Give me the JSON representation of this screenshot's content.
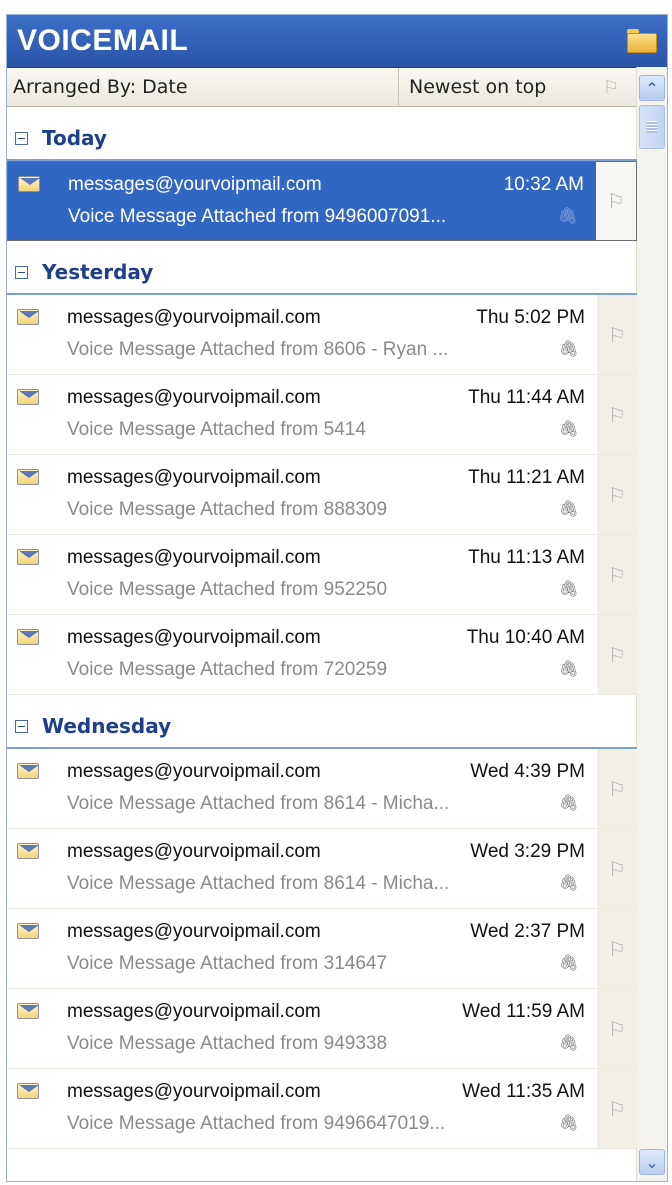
{
  "title": "VOICEMAIL",
  "arrange": {
    "by": "Arranged By: Date",
    "order": "Newest on top"
  },
  "icons": {
    "flag": "⚐",
    "attachment": "🖇",
    "scroll_up": "⌃",
    "scroll_down": "⌄"
  },
  "groups": [
    {
      "title": "Today"
    },
    {
      "title": "Yesterday"
    },
    {
      "title": "Wednesday"
    }
  ],
  "messages": [
    {
      "from": "messages@yourvoipmail.com",
      "time": "10:32 AM",
      "subject": "Voice Message Attached from 9496007091...",
      "selected": true
    },
    {
      "from": "messages@yourvoipmail.com",
      "time": "Thu 5:02 PM",
      "subject": "Voice Message Attached from 8606 - Ryan ..."
    },
    {
      "from": "messages@yourvoipmail.com",
      "time": "Thu 11:44 AM",
      "subject": "Voice Message Attached from 5414"
    },
    {
      "from": "messages@yourvoipmail.com",
      "time": "Thu 11:21 AM",
      "subject": "Voice Message Attached from 888309"
    },
    {
      "from": "messages@yourvoipmail.com",
      "time": "Thu 11:13 AM",
      "subject": "Voice Message Attached from 952250"
    },
    {
      "from": "messages@yourvoipmail.com",
      "time": "Thu 10:40 AM",
      "subject": "Voice Message Attached from 720259"
    },
    {
      "from": "messages@yourvoipmail.com",
      "time": "Wed 4:39 PM",
      "subject": "Voice Message Attached from 8614 - Micha..."
    },
    {
      "from": "messages@yourvoipmail.com",
      "time": "Wed 3:29 PM",
      "subject": "Voice Message Attached from 8614 - Micha..."
    },
    {
      "from": "messages@yourvoipmail.com",
      "time": "Wed 2:37 PM",
      "subject": "Voice Message Attached from 314647"
    },
    {
      "from": "messages@yourvoipmail.com",
      "time": "Wed 11:59 AM",
      "subject": "Voice Message Attached from 949338"
    },
    {
      "from": "messages@yourvoipmail.com",
      "time": "Wed 11:35 AM",
      "subject": "Voice Message Attached from 9496647019..."
    }
  ],
  "colors": {
    "titlebar": "#2a55a6",
    "selected": "#3167c2",
    "group_text": "#1f3f8a"
  }
}
